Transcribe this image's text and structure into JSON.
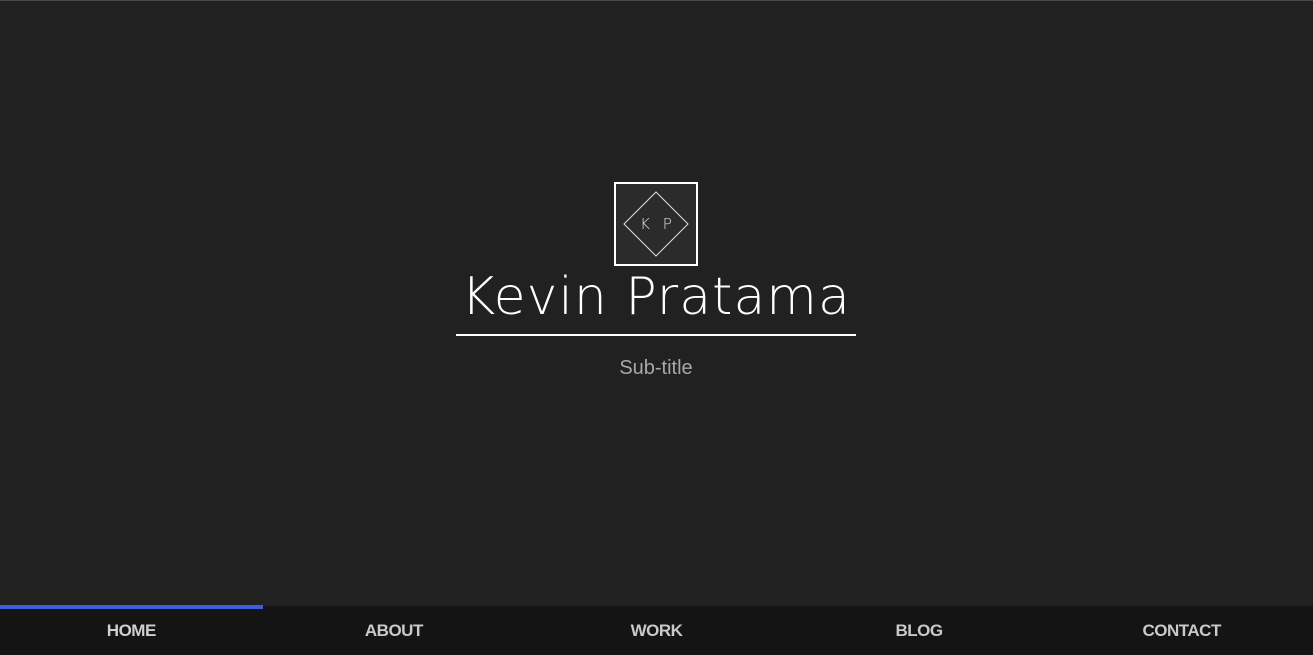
{
  "logo": {
    "initials": "K P"
  },
  "hero": {
    "name": "Kevin Pratama",
    "subtitle": "Sub-title"
  },
  "nav": {
    "items": [
      {
        "label": "HOME",
        "active": true
      },
      {
        "label": "ABOUT",
        "active": false
      },
      {
        "label": "WORK",
        "active": false
      },
      {
        "label": "BLOG",
        "active": false
      },
      {
        "label": "CONTACT",
        "active": false
      }
    ]
  },
  "colors": {
    "background": "#212121",
    "navbar": "#141414",
    "accent": "#3b5fe0",
    "text": "#ffffff",
    "subtitle": "#a8a8a8"
  }
}
